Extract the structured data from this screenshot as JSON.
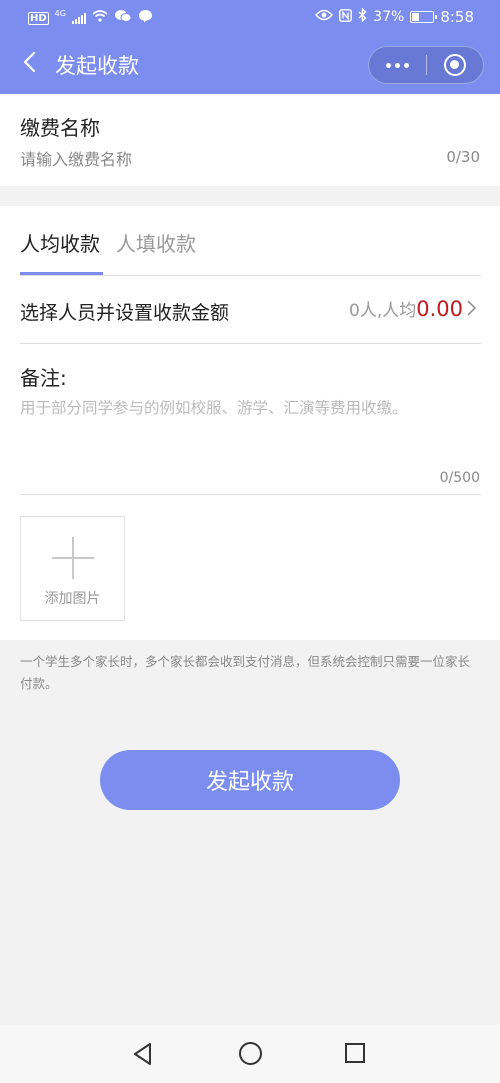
{
  "statusbar": {
    "left_badge": "HD",
    "network": "4G",
    "battery_percent": "37%",
    "battery_level": 0.37,
    "time": "8:58"
  },
  "header": {
    "title": "发起收款",
    "back_icon": "chevron-left-icon",
    "more_icon": "more-dots-icon",
    "close_icon": "target-circle-icon",
    "color": "#7b8ef0"
  },
  "fee": {
    "label": "缴费名称",
    "placeholder": "请输入缴费名称",
    "value": "",
    "count": "0/30"
  },
  "tabs": [
    {
      "label": "人均收款",
      "active": true
    },
    {
      "label": "人填收款",
      "active": false
    }
  ],
  "select_row": {
    "label": "选择人员并设置收款金额",
    "people": "0人,人均",
    "amount": "0.00",
    "amount_color": "#c0191e"
  },
  "remark": {
    "label": "备注:",
    "placeholder": "用于部分同学参与的例如校服、游学、汇演等费用收缴。",
    "value": "",
    "count": "0/500"
  },
  "add_image": {
    "label": "添加图片",
    "icon": "plus-icon"
  },
  "note": "一个学生多个家长时，多个家长都会收到支付消息，但系统会控制只需要一位家长付款。",
  "submit_label": "发起收款",
  "system_nav": [
    "back-triangle-icon",
    "home-circle-icon",
    "recent-square-icon"
  ]
}
